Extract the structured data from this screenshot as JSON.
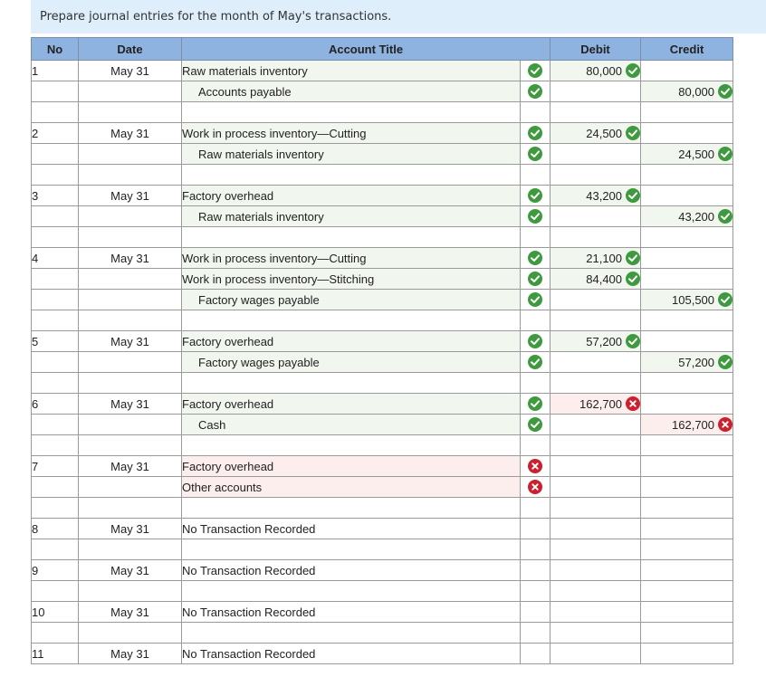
{
  "instruction": "Prepare journal entries for the month of May's transactions.",
  "headers": {
    "no": "No",
    "date": "Date",
    "account": "Account Title",
    "debit": "Debit",
    "credit": "Credit"
  },
  "rows": [
    {
      "no": "1",
      "date": "May 31",
      "account": "Raw materials inventory",
      "indent": false,
      "mark": "correct",
      "debit": "80,000",
      "debit_mark": "correct",
      "credit": "",
      "credit_mark": ""
    },
    {
      "no": "",
      "date": "",
      "account": "Accounts payable",
      "indent": true,
      "mark": "correct",
      "debit": "",
      "debit_mark": "",
      "credit": "80,000",
      "credit_mark": "correct"
    },
    {
      "no": "",
      "date": "",
      "account": "",
      "indent": false,
      "mark": "",
      "debit": "",
      "debit_mark": "",
      "credit": "",
      "credit_mark": ""
    },
    {
      "no": "2",
      "date": "May 31",
      "account": "Work in process inventory—Cutting",
      "indent": false,
      "mark": "correct",
      "debit": "24,500",
      "debit_mark": "correct",
      "credit": "",
      "credit_mark": ""
    },
    {
      "no": "",
      "date": "",
      "account": "Raw materials inventory",
      "indent": true,
      "mark": "correct",
      "debit": "",
      "debit_mark": "",
      "credit": "24,500",
      "credit_mark": "correct"
    },
    {
      "no": "",
      "date": "",
      "account": "",
      "indent": false,
      "mark": "",
      "debit": "",
      "debit_mark": "",
      "credit": "",
      "credit_mark": ""
    },
    {
      "no": "3",
      "date": "May 31",
      "account": "Factory overhead",
      "indent": false,
      "mark": "correct",
      "debit": "43,200",
      "debit_mark": "correct",
      "credit": "",
      "credit_mark": ""
    },
    {
      "no": "",
      "date": "",
      "account": "Raw materials inventory",
      "indent": true,
      "mark": "correct",
      "debit": "",
      "debit_mark": "",
      "credit": "43,200",
      "credit_mark": "correct"
    },
    {
      "no": "",
      "date": "",
      "account": "",
      "indent": false,
      "mark": "",
      "debit": "",
      "debit_mark": "",
      "credit": "",
      "credit_mark": ""
    },
    {
      "no": "4",
      "date": "May 31",
      "account": "Work in process inventory—Cutting",
      "indent": false,
      "mark": "correct",
      "debit": "21,100",
      "debit_mark": "correct",
      "credit": "",
      "credit_mark": ""
    },
    {
      "no": "",
      "date": "",
      "account": "Work in process inventory—Stitching",
      "indent": false,
      "mark": "correct",
      "debit": "84,400",
      "debit_mark": "correct",
      "credit": "",
      "credit_mark": ""
    },
    {
      "no": "",
      "date": "",
      "account": "Factory wages payable",
      "indent": true,
      "mark": "correct",
      "debit": "",
      "debit_mark": "",
      "credit": "105,500",
      "credit_mark": "correct"
    },
    {
      "no": "",
      "date": "",
      "account": "",
      "indent": false,
      "mark": "",
      "debit": "",
      "debit_mark": "",
      "credit": "",
      "credit_mark": ""
    },
    {
      "no": "5",
      "date": "May 31",
      "account": "Factory overhead",
      "indent": false,
      "mark": "correct",
      "debit": "57,200",
      "debit_mark": "correct",
      "credit": "",
      "credit_mark": ""
    },
    {
      "no": "",
      "date": "",
      "account": "Factory wages payable",
      "indent": true,
      "mark": "correct",
      "debit": "",
      "debit_mark": "",
      "credit": "57,200",
      "credit_mark": "correct"
    },
    {
      "no": "",
      "date": "",
      "account": "",
      "indent": false,
      "mark": "",
      "debit": "",
      "debit_mark": "",
      "credit": "",
      "credit_mark": ""
    },
    {
      "no": "6",
      "date": "May 31",
      "account": "Factory overhead",
      "indent": false,
      "mark": "correct",
      "debit": "162,700",
      "debit_mark": "incorrect",
      "credit": "",
      "credit_mark": ""
    },
    {
      "no": "",
      "date": "",
      "account": "Cash",
      "indent": true,
      "mark": "correct",
      "debit": "",
      "debit_mark": "",
      "credit": "162,700",
      "credit_mark": "incorrect"
    },
    {
      "no": "",
      "date": "",
      "account": "",
      "indent": false,
      "mark": "",
      "debit": "",
      "debit_mark": "",
      "credit": "",
      "credit_mark": ""
    },
    {
      "no": "7",
      "date": "May 31",
      "account": "Factory overhead",
      "indent": false,
      "mark": "incorrect",
      "debit": "",
      "debit_mark": "",
      "credit": "",
      "credit_mark": ""
    },
    {
      "no": "",
      "date": "",
      "account": "Other accounts",
      "indent": false,
      "mark": "incorrect",
      "debit": "",
      "debit_mark": "",
      "credit": "",
      "credit_mark": ""
    },
    {
      "no": "",
      "date": "",
      "account": "",
      "indent": false,
      "mark": "",
      "debit": "",
      "debit_mark": "",
      "credit": "",
      "credit_mark": ""
    },
    {
      "no": "8",
      "date": "May 31",
      "account": "No Transaction Recorded",
      "indent": false,
      "mark": "",
      "debit": "",
      "debit_mark": "",
      "credit": "",
      "credit_mark": ""
    },
    {
      "no": "",
      "date": "",
      "account": "",
      "indent": false,
      "mark": "",
      "debit": "",
      "debit_mark": "",
      "credit": "",
      "credit_mark": ""
    },
    {
      "no": "9",
      "date": "May 31",
      "account": "No Transaction Recorded",
      "indent": false,
      "mark": "",
      "debit": "",
      "debit_mark": "",
      "credit": "",
      "credit_mark": ""
    },
    {
      "no": "",
      "date": "",
      "account": "",
      "indent": false,
      "mark": "",
      "debit": "",
      "debit_mark": "",
      "credit": "",
      "credit_mark": ""
    },
    {
      "no": "10",
      "date": "May 31",
      "account": "No Transaction Recorded",
      "indent": false,
      "mark": "",
      "debit": "",
      "debit_mark": "",
      "credit": "",
      "credit_mark": ""
    },
    {
      "no": "",
      "date": "",
      "account": "",
      "indent": false,
      "mark": "",
      "debit": "",
      "debit_mark": "",
      "credit": "",
      "credit_mark": ""
    },
    {
      "no": "11",
      "date": "May 31",
      "account": "No Transaction Recorded",
      "indent": false,
      "mark": "",
      "debit": "",
      "debit_mark": "",
      "credit": "",
      "credit_mark": ""
    }
  ],
  "icons": {
    "correct": "check-circle-icon",
    "incorrect": "x-circle-icon"
  },
  "colors": {
    "header_bg": "#8fb3e0",
    "banner_bg": "#deeefb",
    "correct": "#3f9a3f",
    "incorrect": "#cc1f2f"
  }
}
